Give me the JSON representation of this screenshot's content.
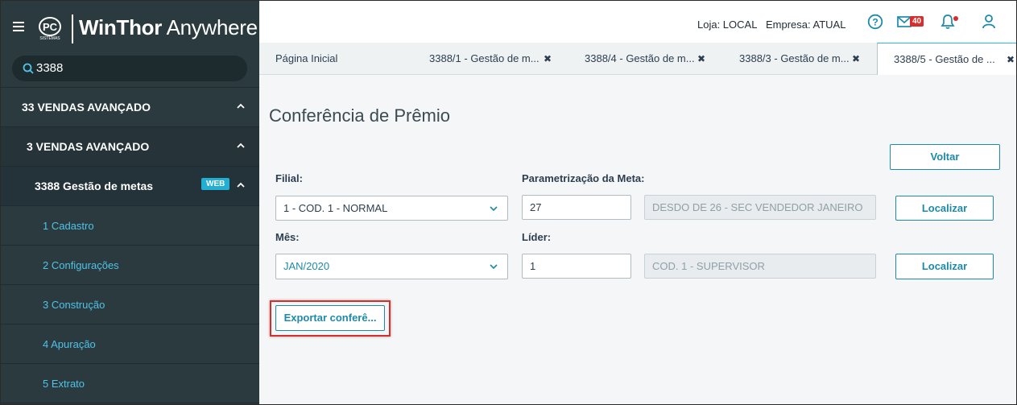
{
  "app": {
    "brand_bold": "WinThor",
    "brand_light": "Anywhere",
    "logo_text": "PC"
  },
  "search": {
    "value": "3388"
  },
  "sidebar": {
    "items": [
      {
        "label": "33  VENDAS AVANÇADO",
        "level": 1,
        "expanded": true
      },
      {
        "label": "3  VENDAS AVANÇADO",
        "level": 2,
        "expanded": true
      },
      {
        "label": "3388  Gestão de metas",
        "level": 3,
        "expanded": true,
        "badge": "WEB"
      },
      {
        "label": "1  Cadastro",
        "level": 4
      },
      {
        "label": "2  Configurações",
        "level": 4
      },
      {
        "label": "3  Construção",
        "level": 4
      },
      {
        "label": "4  Apuração",
        "level": 4
      },
      {
        "label": "5  Extrato",
        "level": 4
      }
    ]
  },
  "header": {
    "loja": "Loja: LOCAL",
    "empresa": "Empresa: ATUAL",
    "mail_count": "40"
  },
  "tabs": [
    {
      "label": "Página Inicial",
      "closable": false,
      "active": false
    },
    {
      "label": "3388/1 - Gestão de m...",
      "closable": true,
      "active": false
    },
    {
      "label": "3388/4 - Gestão de m...",
      "closable": true,
      "active": false
    },
    {
      "label": "3388/3 - Gestão de m...",
      "closable": true,
      "active": false
    },
    {
      "label": "3388/5 - Gestão de ...",
      "closable": true,
      "active": true
    }
  ],
  "page": {
    "title": "Conferência de Prêmio",
    "voltar": "Voltar",
    "filial_label": "Filial:",
    "filial_value": "1 - COD. 1 - NORMAL",
    "param_label": "Parametrização da Meta:",
    "param_code": "27",
    "param_desc": "DESDO DE 26 - SEC VENDEDOR JANEIRO",
    "localizar1": "Localizar",
    "mes_label": "Mês:",
    "mes_value": "JAN/2020",
    "lider_label": "Líder:",
    "lider_code": "1",
    "lider_desc": "COD. 1 - SUPERVISOR",
    "localizar2": "Localizar",
    "exportar": "Exportar conferê..."
  },
  "colors": {
    "sidebar_bg": "#2b3a3f",
    "accent": "#1c8aa8",
    "link": "#4fc3e8",
    "badge": "#21b0d4",
    "alert": "#d62e2e"
  }
}
